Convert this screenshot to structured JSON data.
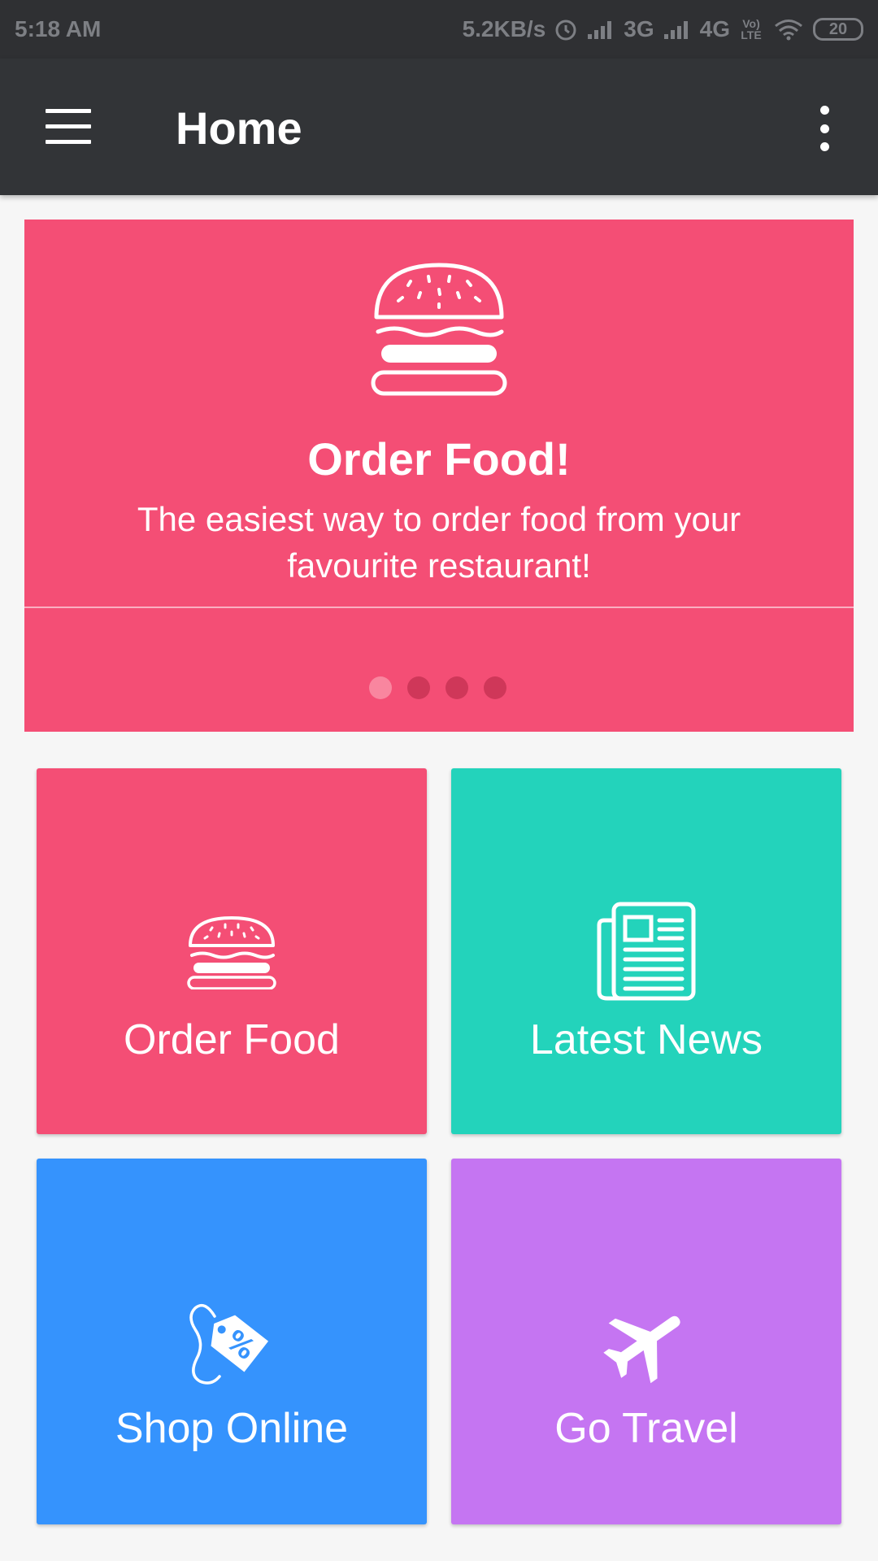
{
  "status_bar": {
    "time": "5:18 AM",
    "network_speed": "5.2KB/s",
    "network_3g": "3G",
    "network_4g": "4G",
    "volte": "Vo) LTE",
    "battery": "20"
  },
  "toolbar": {
    "title": "Home"
  },
  "banner": {
    "title": "Order Food!",
    "description": "The easiest way to order food from your favourite restaurant!",
    "page_count": 4,
    "active_page": 1,
    "color": "#f44e75"
  },
  "tiles": [
    {
      "label": "Order Food",
      "icon": "burger-icon",
      "color": "#f44e75"
    },
    {
      "label": "Latest News",
      "icon": "newspaper-icon",
      "color": "#23d3bb"
    },
    {
      "label": "Shop Online",
      "icon": "price-tag-icon",
      "color": "#3593fd"
    },
    {
      "label": "Go Travel",
      "icon": "airplane-icon",
      "color": "#c575f2"
    }
  ]
}
